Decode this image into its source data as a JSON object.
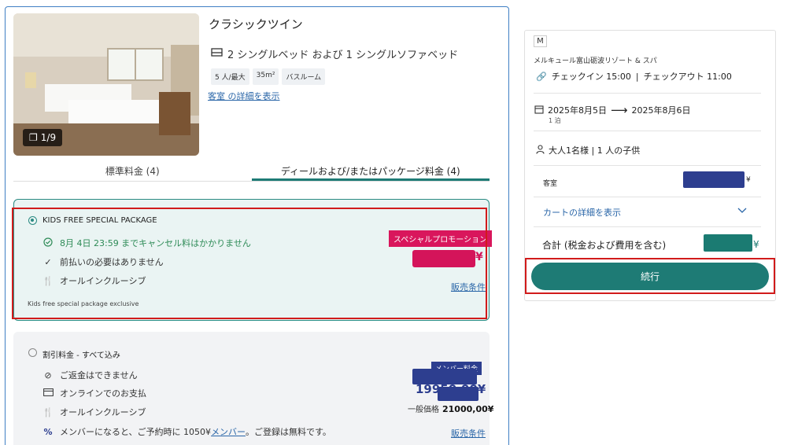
{
  "room": {
    "photo_count": "1/9",
    "title": "クラシックツイン",
    "beds": "2 シングルベッド および 1 シングルソファベッド",
    "tags": [
      "5 人/最大",
      "35m²",
      "バスルーム"
    ],
    "details_link": "客室 の詳細を表示"
  },
  "tabs": [
    {
      "label": "標準料金 (4)",
      "active": false
    },
    {
      "label": "ディールおよび/またはパッケージ料金 (4)",
      "active": true
    }
  ],
  "kids_rate": {
    "name": "KIDS FREE SPECIAL PACKAGE",
    "cancel": "8月 4日 23:59 までキャンセル料はかかりません",
    "prepay": "前払いの必要はありません",
    "inclusive": "オールインクルーシブ",
    "note": "Kids free special package exclusive",
    "promo": "スペシャルプロモーション",
    "yen": "¥",
    "terms": "販売条件"
  },
  "discount_rate": {
    "name": "割引料金 - すべて込み",
    "refund": "ご返金はできません",
    "payment": "オンラインでのお支払",
    "inclusive": "オールインクルーシブ",
    "member_pre": "メンバーになると、ご予約時に 1050¥",
    "member_link": "メンバー",
    "member_post": "。ご登録は無料です。",
    "member_tag": "メンバー料金",
    "member_price": "19950,00¥",
    "normal_label": "一般価格",
    "normal_price": "21000,00¥",
    "terms": "販売条件"
  },
  "summary": {
    "logo": "M",
    "hotel": "メルキュール富山砺波リゾート & スパ",
    "checkin": "チェックイン 15:00",
    "separator": "|",
    "checkout": "チェックアウト 11:00",
    "date_from": "2025年8月5日",
    "date_to": "2025年8月6日",
    "nights": "1 泊",
    "guests": "大人1名様 | 1 人の子供",
    "room_label": "客室",
    "yen": "¥",
    "cart_link": "カートの詳細を表示",
    "total": "合計 (税金および費用を含む)",
    "continue": "続行"
  }
}
